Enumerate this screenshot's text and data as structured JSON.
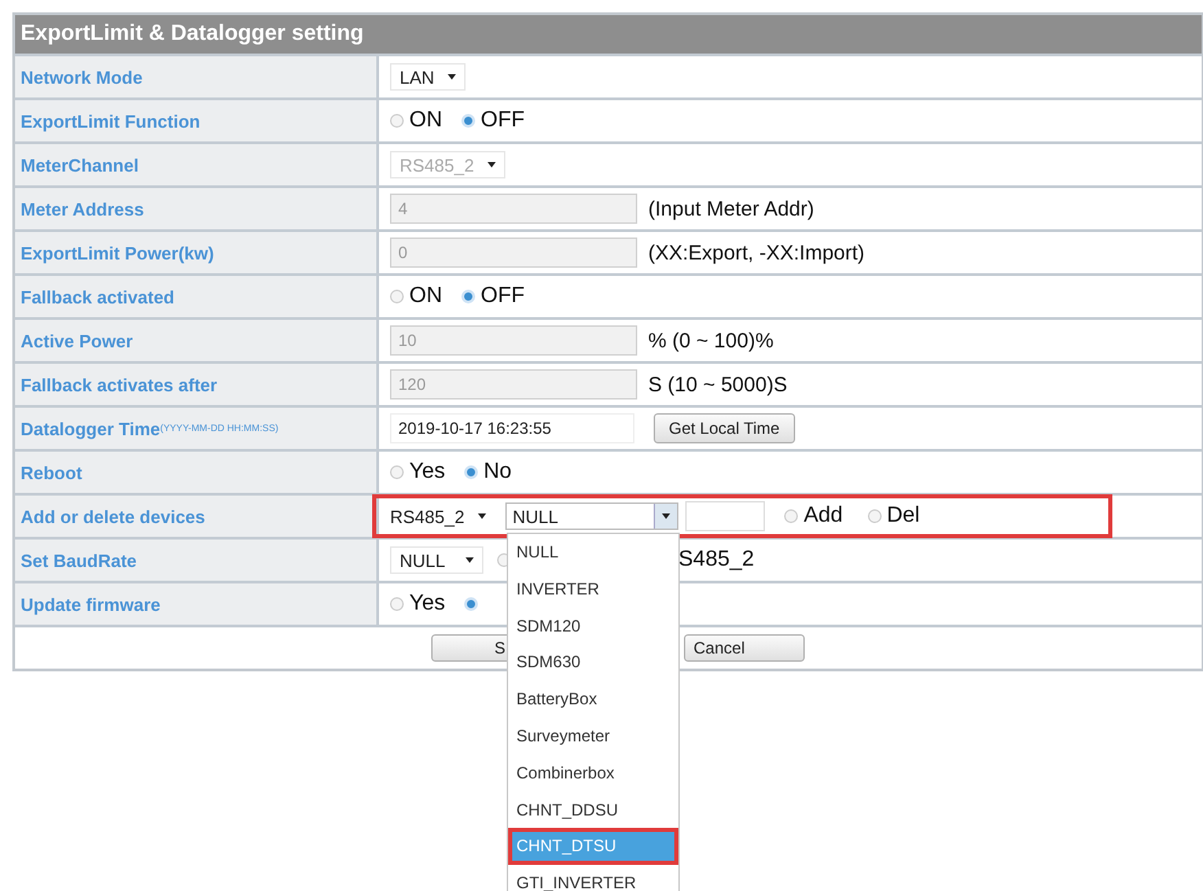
{
  "title": "ExportLimit & Datalogger setting",
  "rows": [
    {
      "label": "Network Mode",
      "kind": "select",
      "value": "LAN",
      "disabled": false
    },
    {
      "label": "ExportLimit Function",
      "kind": "radio",
      "options": [
        {
          "label": "ON",
          "selected": false
        },
        {
          "label": "OFF",
          "selected": true
        }
      ]
    },
    {
      "label": "MeterChannel",
      "kind": "select",
      "value": "RS485_2",
      "disabled": true
    },
    {
      "label": "Meter Address",
      "kind": "input",
      "value": "4",
      "disabled": true,
      "note": "(Input Meter Addr)"
    },
    {
      "label": "ExportLimit Power(kw)",
      "kind": "input",
      "value": "0",
      "disabled": true,
      "note": "(XX:Export, -XX:Import)"
    },
    {
      "label": "Fallback activated",
      "kind": "radio",
      "options": [
        {
          "label": "ON",
          "selected": false
        },
        {
          "label": "OFF",
          "selected": true
        }
      ]
    },
    {
      "label": "Active Power",
      "kind": "input",
      "value": "10",
      "disabled": true,
      "note": "% (0 ~ 100)%"
    },
    {
      "label": "Fallback activates after",
      "kind": "input",
      "value": "120",
      "disabled": true,
      "note": "S (10 ~ 5000)S"
    },
    {
      "label": "Datalogger Time",
      "label_note": "(YYYY-MM-DD HH:MM:SS)",
      "kind": "datetime",
      "value": "2019-10-17 16:23:55",
      "button": "Get Local Time"
    },
    {
      "label": "Reboot",
      "kind": "radio",
      "options": [
        {
          "label": "Yes",
          "selected": false
        },
        {
          "label": "No",
          "selected": true
        }
      ]
    },
    {
      "label": "Add or delete devices",
      "kind": "devices",
      "channel": "RS485_2",
      "device": "NULL",
      "highlighted": true,
      "options": [
        {
          "label": "Add",
          "selected": false
        },
        {
          "label": "Del",
          "selected": false
        }
      ]
    },
    {
      "label": "Set BaudRate",
      "kind": "baud",
      "value": "NULL",
      "options": [
        {
          "selected": false
        }
      ],
      "note": "S485_2"
    },
    {
      "label": "Update firmware",
      "kind": "radio",
      "options": [
        {
          "label": "Yes",
          "selected": false
        },
        {
          "selected": true
        }
      ]
    }
  ],
  "buttons": [
    "S",
    "Cancel"
  ],
  "dropdown": {
    "items": [
      {
        "label": "NULL",
        "selected": false,
        "highlighted": false
      },
      {
        "label": "INVERTER",
        "selected": false,
        "highlighted": false
      },
      {
        "label": "SDM120",
        "selected": false,
        "highlighted": false
      },
      {
        "label": "SDM630",
        "selected": false,
        "highlighted": false
      },
      {
        "label": "BatteryBox",
        "selected": false,
        "highlighted": false
      },
      {
        "label": "Surveymeter",
        "selected": false,
        "highlighted": false
      },
      {
        "label": "Combinerbox",
        "selected": false,
        "highlighted": false
      },
      {
        "label": "CHNT_DDSU",
        "selected": false,
        "highlighted": false
      },
      {
        "label": "CHNT_DTSU",
        "selected": true,
        "highlighted": true
      },
      {
        "label": "GTI_INVERTER",
        "selected": false,
        "highlighted": false
      }
    ]
  }
}
